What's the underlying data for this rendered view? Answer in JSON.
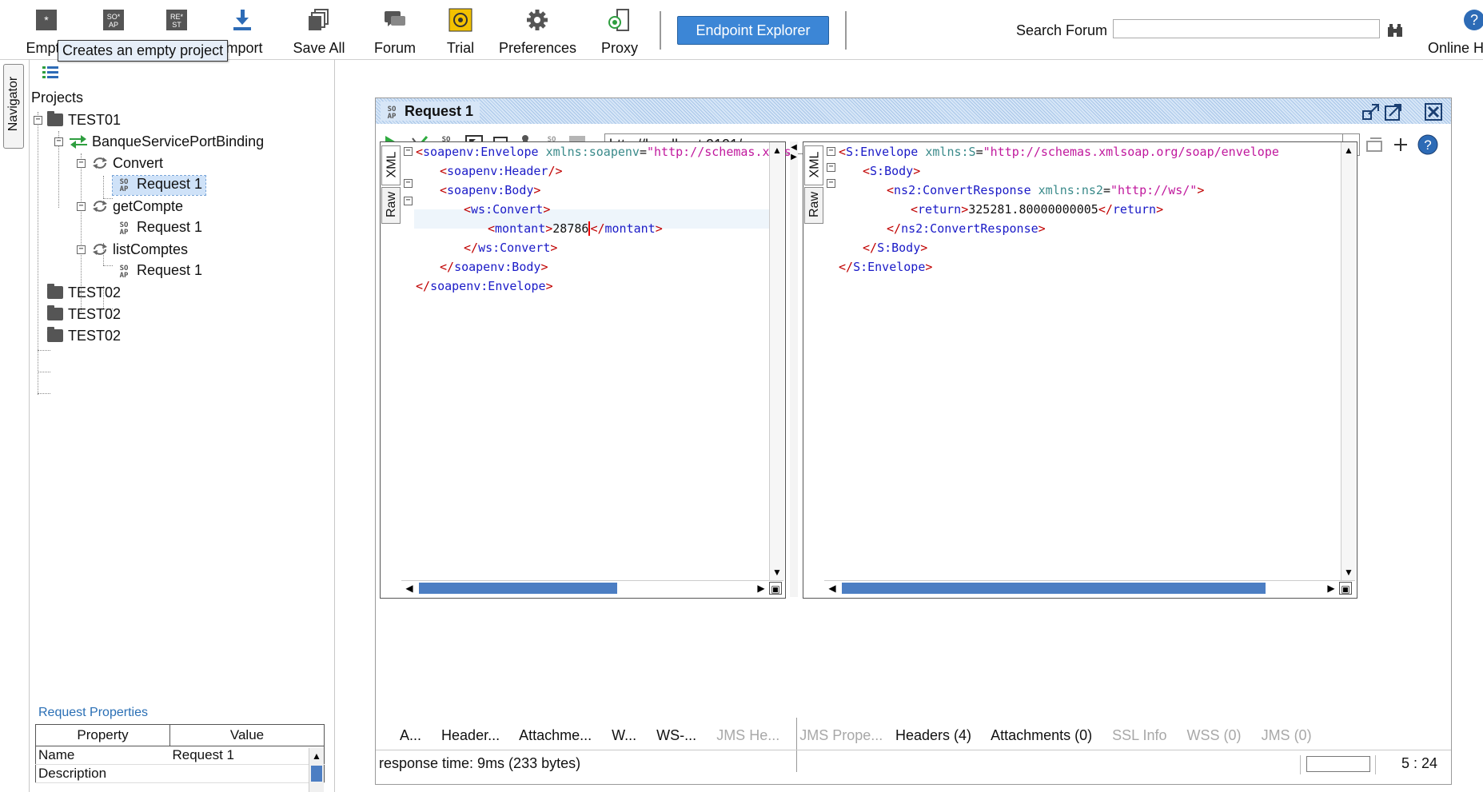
{
  "toolbar": {
    "buttons": [
      {
        "label": "Empty"
      },
      {
        "label": ""
      },
      {
        "label": ""
      },
      {
        "label": "Import"
      },
      {
        "label": "Save All"
      },
      {
        "label": "Forum"
      },
      {
        "label": "Trial"
      },
      {
        "label": "Preferences"
      },
      {
        "label": "Proxy"
      }
    ],
    "tooltip": "Creates an empty project",
    "endpoint_explorer": "Endpoint Explorer",
    "search_label": "Search Forum",
    "search_value": "",
    "online_help": "Online H"
  },
  "navigator": {
    "tab_label": "Navigator"
  },
  "tree": {
    "root": "Projects",
    "items": [
      {
        "label": "TEST01"
      },
      {
        "label": "BanqueServicePortBinding"
      },
      {
        "label": "Convert"
      },
      {
        "label": "Request 1"
      },
      {
        "label": "getCompte"
      },
      {
        "label": "Request 1"
      },
      {
        "label": "listComptes"
      },
      {
        "label": "Request 1"
      },
      {
        "label": "TEST02"
      },
      {
        "label": "TEST02"
      },
      {
        "label": "TEST02"
      }
    ]
  },
  "properties": {
    "title": "Request Properties",
    "columns": [
      "Property",
      "Value"
    ],
    "rows": [
      {
        "property": "Name",
        "value": "Request 1"
      },
      {
        "property": "Description",
        "value": ""
      }
    ]
  },
  "request": {
    "title": "Request 1",
    "url": "http://localhost:9191/",
    "request_lines": [
      "<soapenv:Envelope xmlns:soapenv=\"http://schemas.xmls",
      "<soapenv:Header/>",
      "<soapenv:Body>",
      "<ws:Convert>",
      "<montant>28786</montant>",
      "</ws:Convert>",
      "</soapenv:Body>",
      "</soapenv:Envelope>"
    ],
    "response_lines": [
      "<S:Envelope xmlns:S=\"http://schemas.xmlsoap.org/soap/envelope",
      "<S:Body>",
      "<ns2:ConvertResponse xmlns:ns2=\"http://ws/\">",
      "<return>325281.80000000005</return>",
      "</ns2:ConvertResponse>",
      "</S:Body>",
      "</S:Envelope>"
    ],
    "side_tabs": {
      "xml": "XML",
      "raw": "Raw"
    },
    "request_tabs": [
      "A...",
      "Header...",
      "Attachme...",
      "W...",
      "WS-...",
      "JMS He...",
      "JMS Prope..."
    ],
    "response_tabs": [
      "Headers (4)",
      "Attachments (0)",
      "SSL Info",
      "WSS (0)",
      "JMS (0)"
    ],
    "status": "response time: 9ms (233 bytes)",
    "cursor_pos": "5 : 24"
  },
  "colors": {
    "accent": "#3c86d6",
    "selection": "#cfe2f8",
    "tag": "#1a1ac7",
    "bracket": "#c00000",
    "value": "#c0189d"
  }
}
